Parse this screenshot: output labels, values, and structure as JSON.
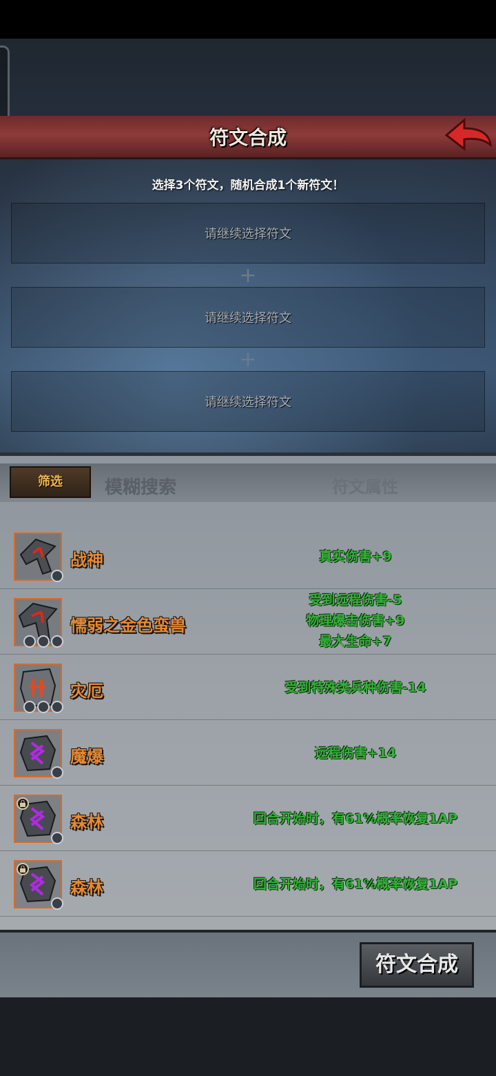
{
  "header": {
    "title": "符文合成"
  },
  "selection": {
    "instruction": "选择3个符文，随机合成1个新符文！",
    "slots": [
      {
        "placeholder": "请继续选择符文"
      },
      {
        "placeholder": "请继续选择符文"
      },
      {
        "placeholder": "请继续选择符文"
      }
    ]
  },
  "list_header": {
    "filter_label": "筛选",
    "search_label": "模糊搜索",
    "attr_label": "符文属性"
  },
  "runes": [
    {
      "name": "战神",
      "attrs": [
        "真实伤害+9"
      ],
      "locked": false,
      "icon": "axe-rune-icon"
    },
    {
      "name": "懦弱之金色蛮兽",
      "attrs": [
        "受到远程伤害-5",
        "物理爆击伤害+9",
        "最大生命+7"
      ],
      "locked": false,
      "icon": "axe-rune-icon"
    },
    {
      "name": "灾厄",
      "attrs": [
        "受到特殊类兵种伤害-14"
      ],
      "locked": false,
      "icon": "stone-rune-icon"
    },
    {
      "name": "魔爆",
      "attrs": [
        "远程伤害+14"
      ],
      "locked": false,
      "icon": "purple-rune-icon"
    },
    {
      "name": "森林",
      "attrs": [
        "回合开始时，有61%概率恢复1AP"
      ],
      "locked": true,
      "icon": "purple-rune-icon"
    },
    {
      "name": "森林",
      "attrs": [
        "回合开始时，有61%概率恢复1AP"
      ],
      "locked": true,
      "icon": "purple-rune-icon"
    }
  ],
  "footer": {
    "compose_label": "符文合成"
  },
  "colors": {
    "title_bar": "#8e3b3a",
    "rune_name": "#e58a35",
    "attr_text": "#35b23a",
    "filter_text": "#f0b64a"
  }
}
